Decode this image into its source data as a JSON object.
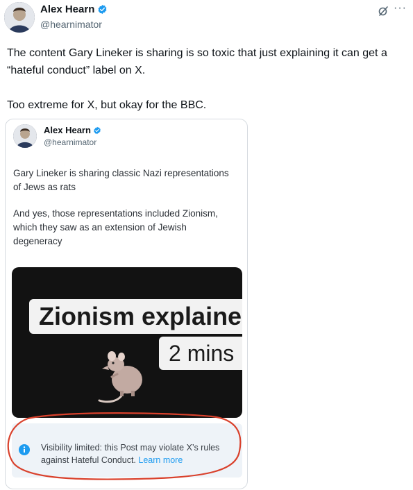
{
  "outer_post": {
    "author_name": "Alex Hearn",
    "handle": "@hearnimator",
    "paragraphs": [
      "The content Gary Lineker is sharing is so toxic that just explaining it can get a “hateful conduct” label on X.",
      "Too extreme for X, but okay for the BBC."
    ]
  },
  "embedded_post": {
    "author_name": "Alex Hearn",
    "handle": "@hearnimator",
    "paragraphs": [
      "Gary Lineker is sharing classic Nazi representations of Jews as rats",
      "And yes, those representations included Zionism, which they saw as an extension of Jewish degeneracy"
    ],
    "video": {
      "title_line1": "Zionism explained",
      "title_line2": "2 mins"
    },
    "notice": {
      "text": "Visibility limited: this Post may violate X’s rules against Hateful Conduct.",
      "link": "Learn more"
    }
  },
  "colors": {
    "verified_blue": "#1d9bf0",
    "annotation_red": "#d9412c",
    "notice_bg": "#eef3f8"
  },
  "icons": {
    "verified": "verified-badge-icon",
    "grok": "grok-icon",
    "more": "more-options-icon",
    "info": "info-icon"
  },
  "more_glyph": "···"
}
